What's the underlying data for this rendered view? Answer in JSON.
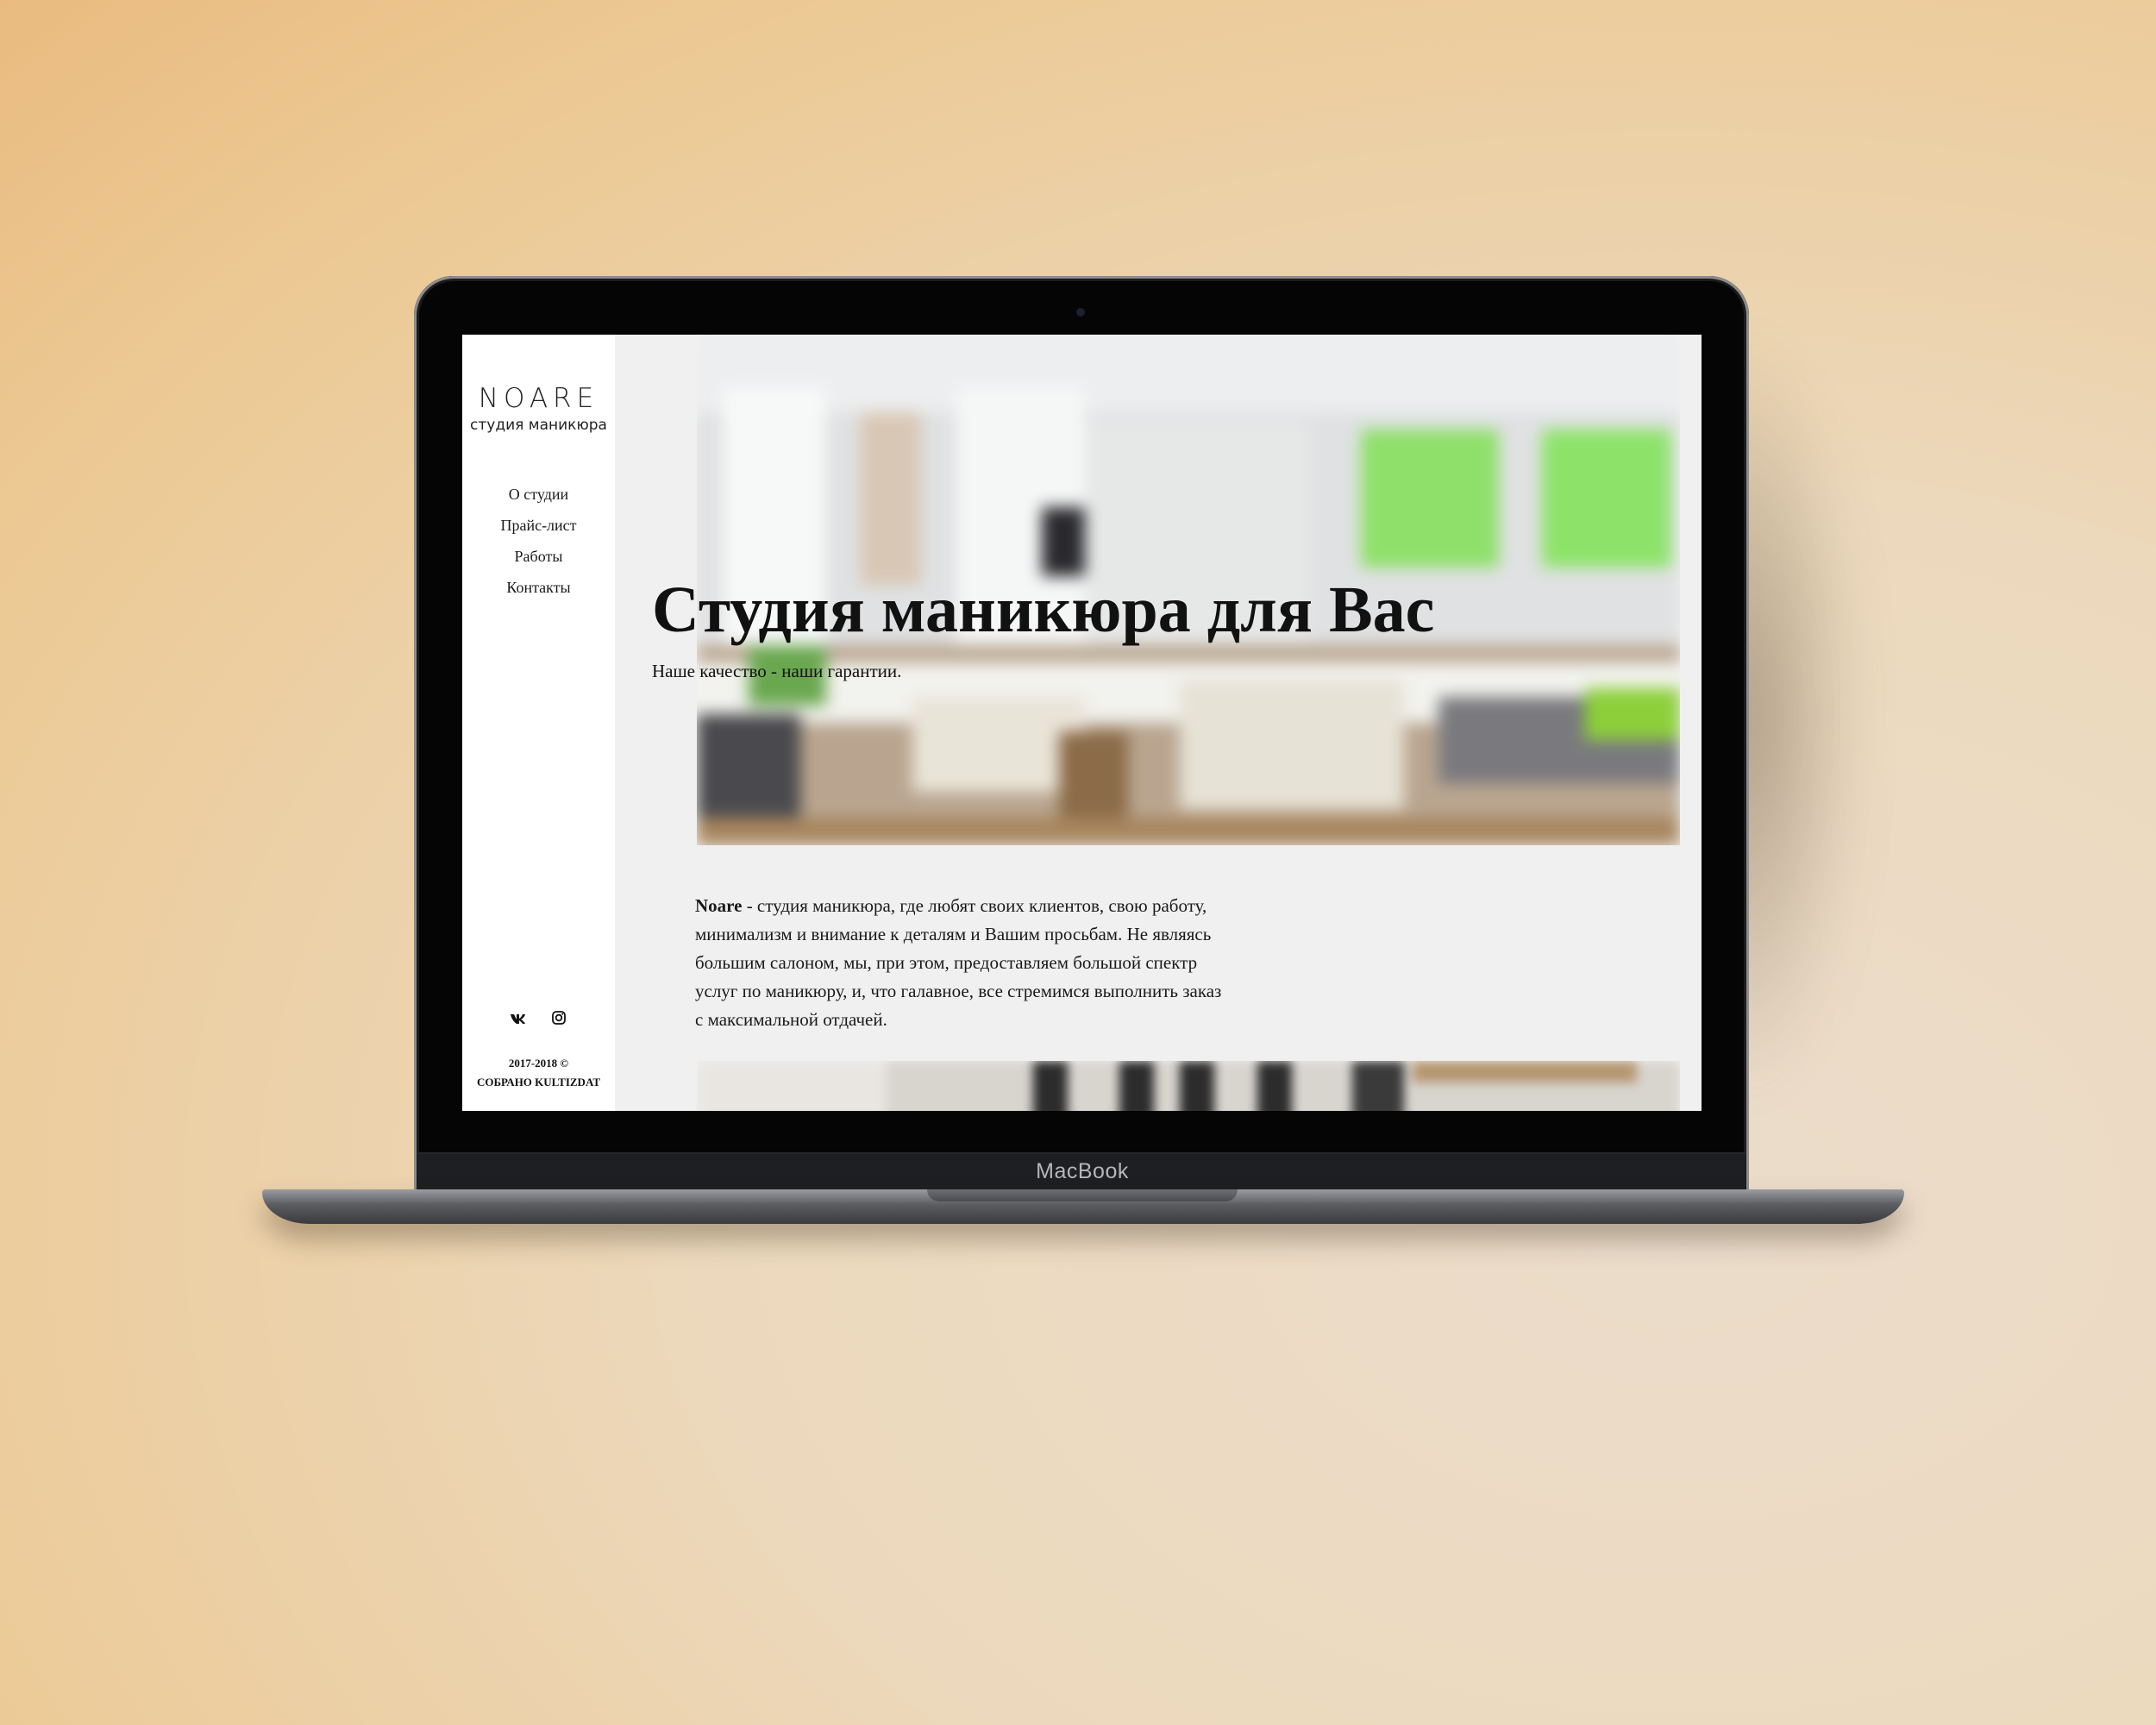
{
  "device": {
    "brand_label": "MacBook"
  },
  "sidebar": {
    "logo": "NOARE",
    "logo_subtitle": "студия маникюра",
    "nav": [
      {
        "label": "О студии"
      },
      {
        "label": "Прайс-лист"
      },
      {
        "label": "Работы"
      },
      {
        "label": "Контакты"
      }
    ],
    "social": [
      "vk-icon",
      "instagram-icon"
    ],
    "copyright_line1": "2017-2018 ©",
    "copyright_line2": "СОБРАНО KULTIZDAT"
  },
  "hero": {
    "title": "Студия маникюра для Вас",
    "subtitle": "Наше качество - наши гарантии."
  },
  "about": {
    "brand": "Noare",
    "text": " - студия маникюра, где любят своих клиентов, свою работу, минимализм и внимание к деталям и Вашим просьбам. Не являясь большим салоном, мы, при этом, предоставляем большой спектр услуг по маникюру, и, что галавное, все стремимся выполнить заказ с максимальной отдачей."
  },
  "colors": {
    "accent_green": "#7fd44a",
    "sidebar_bg": "#ffffff",
    "content_bg": "#f0f0f0"
  }
}
